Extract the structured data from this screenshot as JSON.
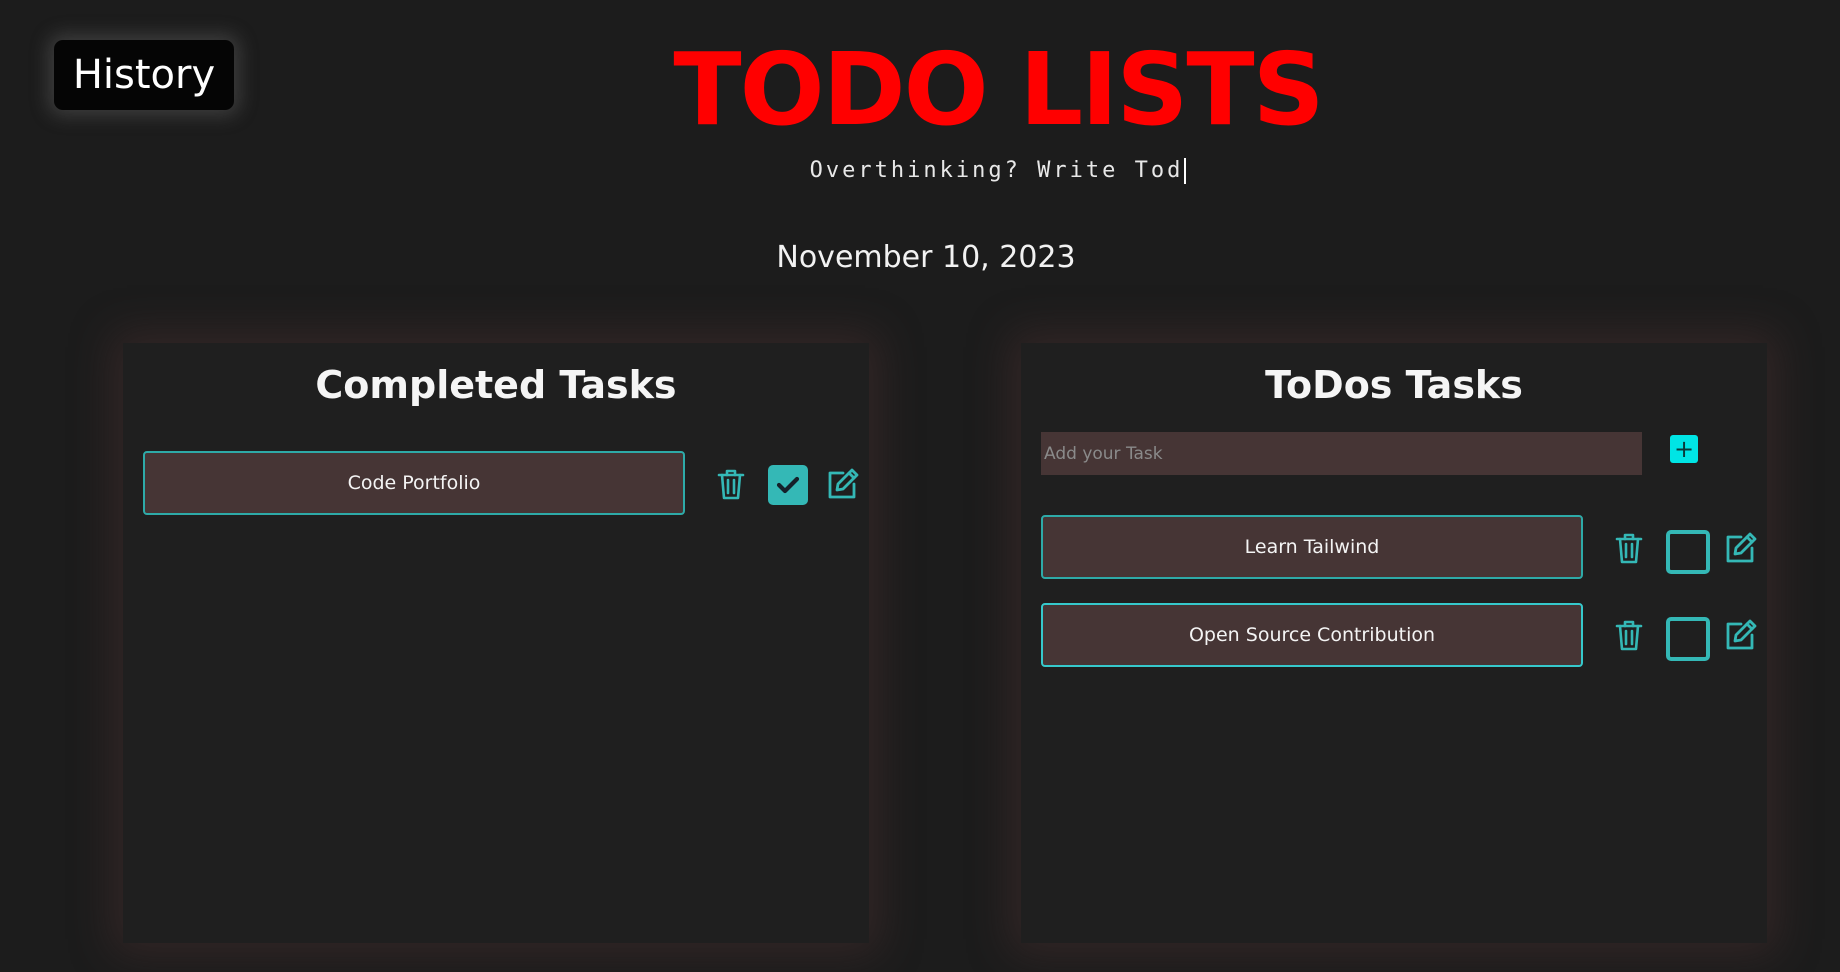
{
  "header": {
    "history_label": "History",
    "title": "TODO LISTS",
    "tagline": "Overthinking? Write Tod",
    "date": "November 10, 2023"
  },
  "completed": {
    "title": "Completed Tasks",
    "tasks": [
      {
        "label": "Code Portfolio",
        "done": true
      }
    ]
  },
  "todos": {
    "title": "ToDos Tasks",
    "input_placeholder": "Add your Task",
    "input_value": "",
    "add_label": "+",
    "tasks": [
      {
        "label": "Learn Tailwind",
        "done": false
      },
      {
        "label": "Open Source Contribution",
        "done": false
      }
    ]
  },
  "icons": {
    "delete": "trash-icon",
    "edit": "edit-icon",
    "check": "checkmark-icon"
  },
  "colors": {
    "title": "#ff0000",
    "accent": "#34b8b6",
    "add_button": "#00e5e5",
    "task_bg": "#463535",
    "background": "#1c1c1c"
  }
}
